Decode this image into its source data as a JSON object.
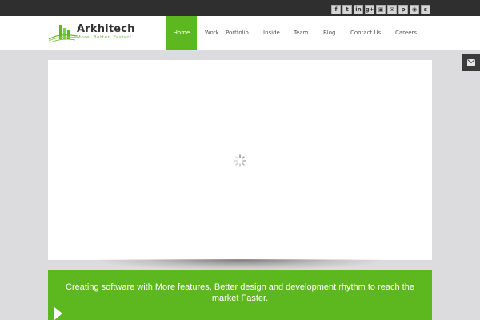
{
  "social": [
    "f",
    "t",
    "in",
    "g+",
    "▣",
    "✉",
    "p",
    "◉",
    "s"
  ],
  "logo": {
    "name": "Arkhitech",
    "tagline": "More. Better. Faster!"
  },
  "nav": [
    {
      "label": "Home",
      "active": true
    },
    {
      "label": "Work",
      "active": false
    },
    {
      "label": "Portfolio",
      "active": false
    },
    {
      "label": "Inside",
      "active": false
    },
    {
      "label": "Team",
      "active": false
    },
    {
      "label": "Blog",
      "active": false
    },
    {
      "label": "Contact Us",
      "active": false
    },
    {
      "label": "Careers",
      "active": false
    }
  ],
  "banner": {
    "text": "Creating software with More features, Better design and development rhythm to reach the market Faster."
  },
  "colors": {
    "accent": "#5cb81e",
    "topbar": "#2f2f2f",
    "background": "#dcdcde"
  },
  "icons": {
    "contact_tab": "envelope-icon",
    "loader": "spinner-icon"
  }
}
